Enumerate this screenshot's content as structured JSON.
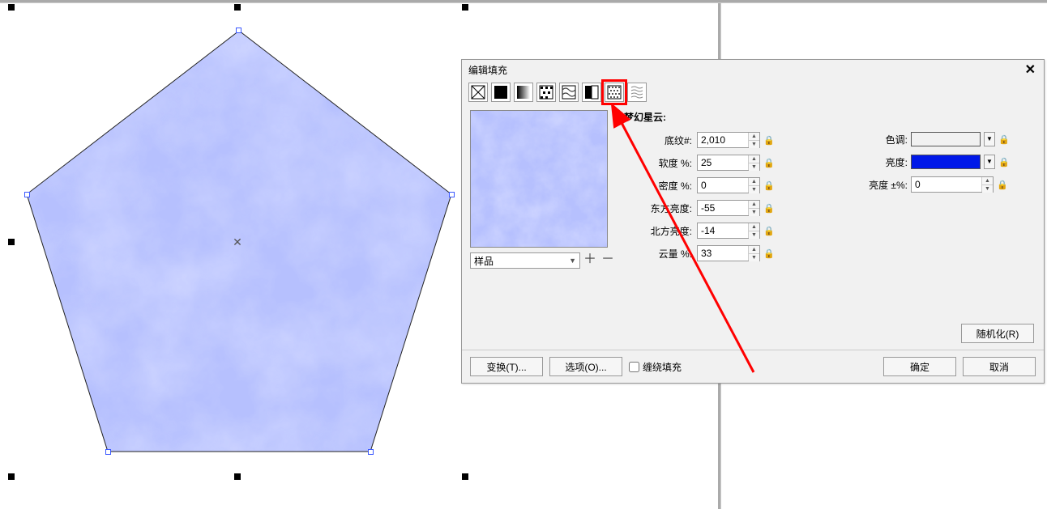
{
  "dialog": {
    "title": "编辑填充",
    "section_title": "梦幻星云:",
    "swatch_label": "样品",
    "params": {
      "texture_no_label": "底纹#:",
      "texture_no_value": "2,010",
      "softness_label": "软度 %:",
      "softness_value": "25",
      "density_label": "密度 %:",
      "density_value": "0",
      "east_label": "东方亮度:",
      "east_value": "-55",
      "north_label": "北方亮度:",
      "north_value": "-14",
      "cloud_label": "云量 %:",
      "cloud_value": "33"
    },
    "colors": {
      "hue_label": "色调:",
      "hue_value": "#e9edf8",
      "brightness_label": "亮度:",
      "brightness_value": "#0018e8",
      "brightness_pm_label": "亮度 ±%:",
      "brightness_pm_value": "0"
    },
    "buttons": {
      "randomize": "随机化(R)",
      "transform": "变换(T)...",
      "options": "选项(O)...",
      "wrap_fill": "缠绕填充",
      "ok": "确定",
      "cancel": "取消"
    }
  }
}
